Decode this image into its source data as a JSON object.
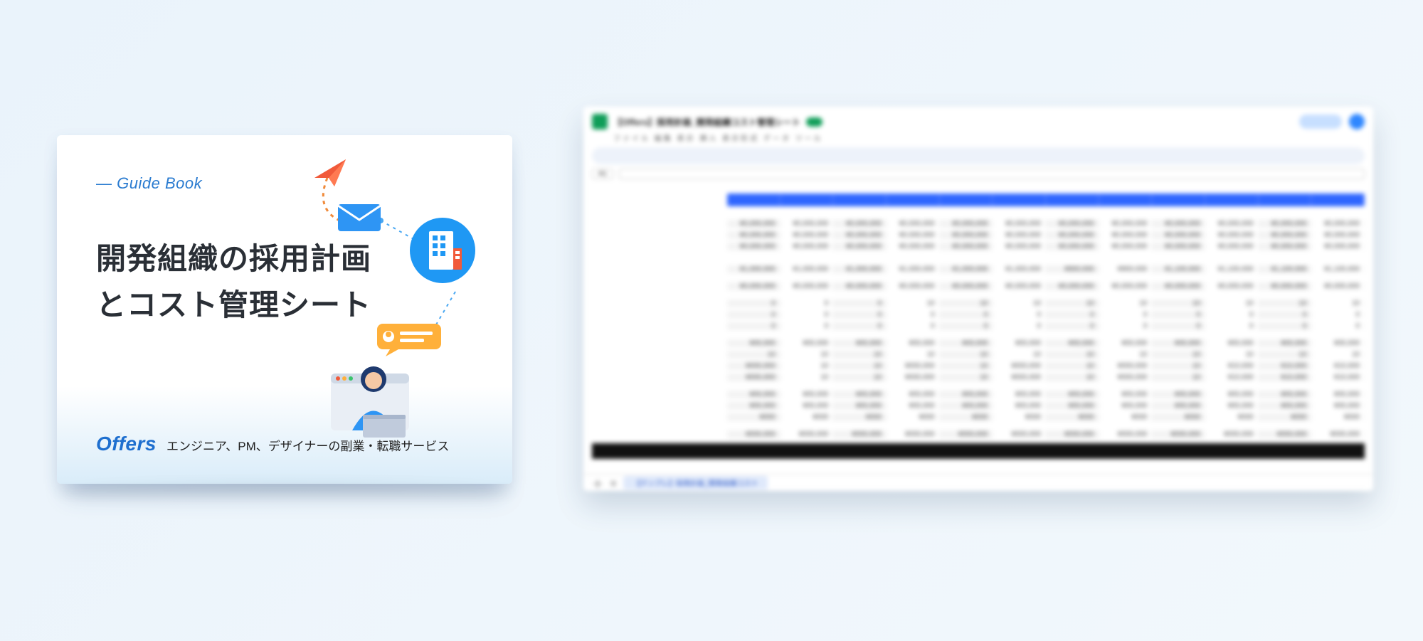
{
  "book": {
    "label": "Guide Book",
    "title_line1": "開発組織の採用計画",
    "title_line2": "とコスト管理シート",
    "brand": "Offers",
    "tagline": "エンジニア、PM、デザイナーの副業・転職サービス"
  },
  "sheet": {
    "doc_title": "【Offers】採用計画_開発組織コスト管理シート",
    "share": "共有",
    "cell_ref": "A1",
    "tab": "【テンプレ】採用計画_開発組織コスト"
  },
  "icons": {
    "plane": "paper-plane-icon",
    "envelope": "envelope-icon",
    "building": "building-icon",
    "speech": "speech-bubble-icon",
    "person": "person-laptop-icon"
  },
  "colors": {
    "accent": "#2a7bd0",
    "sheet_header": "#2f66ff"
  }
}
